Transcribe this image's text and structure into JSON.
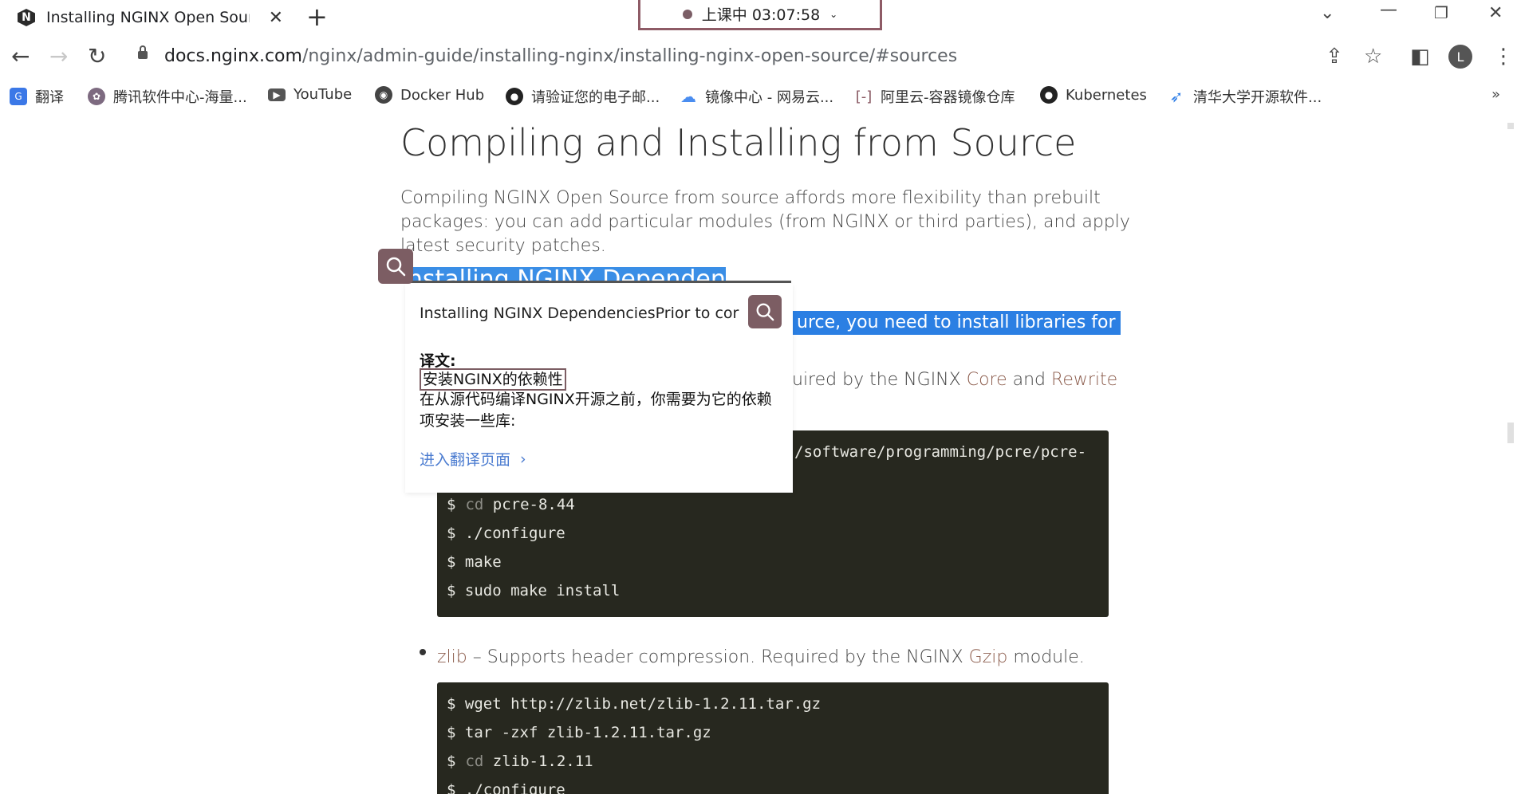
{
  "browser": {
    "tab_title": "Installing NGINX Open Source",
    "tab_favicon_letter": "N",
    "recording_label": "上课中 03:07:58",
    "url_host": "docs.nginx.com",
    "url_path": "/nginx/admin-guide/installing-nginx/installing-nginx-open-source/#sources",
    "avatar_letter": "L"
  },
  "bookmarks": [
    {
      "label": "翻译",
      "icon": "translate-icon",
      "color": "#3b78e7"
    },
    {
      "label": "腾讯软件中心-海量...",
      "icon": "tencent-icon",
      "color": "#7d6a80"
    },
    {
      "label": "YouTube",
      "icon": "youtube-icon",
      "color": "#555555"
    },
    {
      "label": "Docker Hub",
      "icon": "docker-icon",
      "color": "#444444"
    },
    {
      "label": "请验证您的电子邮...",
      "icon": "github-icon",
      "color": "#222222"
    },
    {
      "label": "镜像中心 - 网易云...",
      "icon": "cloud-icon",
      "color": "#4a8df0"
    },
    {
      "label": "阿里云-容器镜像仓库",
      "icon": "aliyun-icon",
      "color": "#8a5a64"
    },
    {
      "label": "Kubernetes",
      "icon": "github-icon",
      "color": "#222222"
    },
    {
      "label": "清华大学开源软件...",
      "icon": "tsinghua-icon",
      "color": "#2f7ee6"
    }
  ],
  "content": {
    "heading": "Compiling and Installing from Source",
    "intro": "Compiling NGINX Open Source from source affords more flexibility than prebuilt packages: you can add particular modules (from NGINX or third parties), and apply latest security patches.",
    "subheading_partial": "Installing NGINX Dependencies",
    "selected_fragment": "urce, you need to install libraries for",
    "pcre_line_prefix": "uired by the NGINX ",
    "pcre_link_core": "Core",
    "pcre_line_and": " and ",
    "pcre_link_rewrite": "Rewrite",
    "code1_visible": "/software/programming/pcre/pcre-",
    "code1_lines": [
      {
        "prompt": "$",
        "cmd": "cd",
        "rest": " pcre-8.44"
      },
      {
        "prompt": "$",
        "cmd": "",
        "rest": " ./configure"
      },
      {
        "prompt": "$",
        "cmd": "",
        "rest": " make"
      },
      {
        "prompt": "$",
        "cmd": "",
        "rest": " sudo make install"
      }
    ],
    "zlib_link": "zlib",
    "zlib_text_a": " – Supports header compression. Required by the NGINX ",
    "zlib_link_gzip": "Gzip",
    "zlib_text_b": " module.",
    "code2_lines": [
      {
        "prompt": "$",
        "cmd": "",
        "rest": " wget http://zlib.net/zlib-1.2.11.tar.gz"
      },
      {
        "prompt": "$",
        "cmd": "",
        "rest": " tar -zxf zlib-1.2.11.tar.gz"
      },
      {
        "prompt": "$",
        "cmd": "cd",
        "rest": " zlib-1.2.11"
      },
      {
        "prompt": "$",
        "cmd": "",
        "rest": " ./configure"
      }
    ]
  },
  "popup": {
    "source_text": "Installing NGINX DependenciesPrior to cor",
    "label": "译文:",
    "translation_title": "安装NGINX的依赖性",
    "translation_body": "在从源代码编译NGINX开源之前，你需要为它的依赖项安装一些库:",
    "link": "进入翻译页面"
  }
}
